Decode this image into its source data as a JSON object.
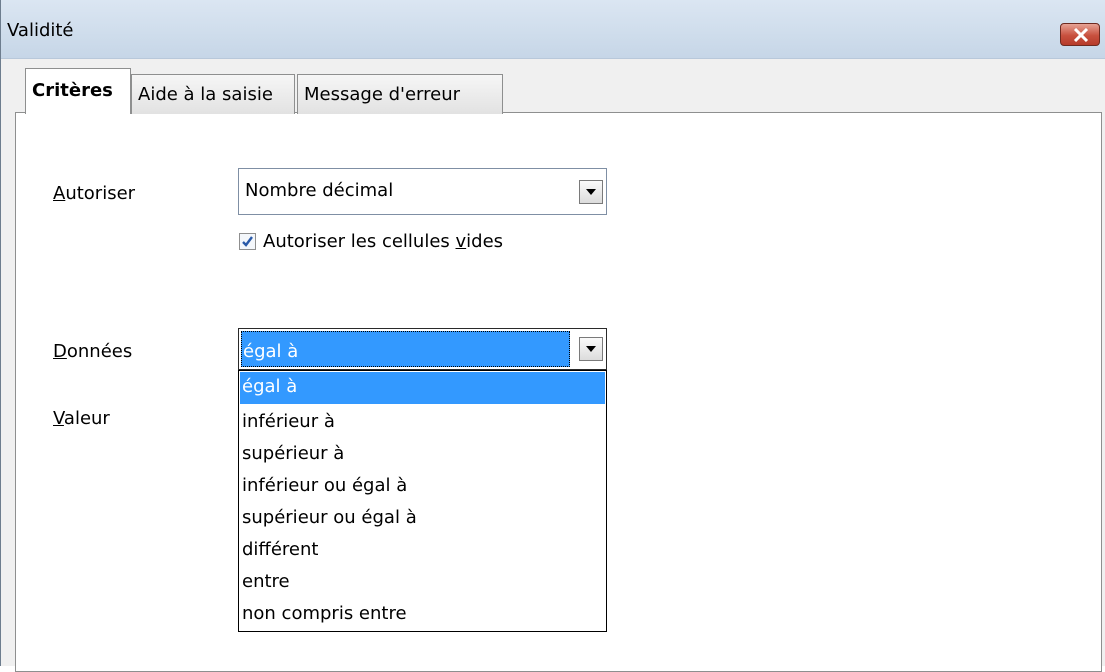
{
  "window": {
    "title": "Validité"
  },
  "tabs": [
    {
      "label": "Critères",
      "active": true
    },
    {
      "label": "Aide à la saisie",
      "active": false
    },
    {
      "label": "Message d'erreur",
      "active": false
    }
  ],
  "criteria": {
    "allow": {
      "label_accel": "A",
      "label_rest": "utoriser",
      "value": "Nombre décimal"
    },
    "allow_empty": {
      "checked": true,
      "label_pre": "Autoriser les cellules ",
      "label_accel": "v",
      "label_post": "ides"
    },
    "data": {
      "label_accel": "D",
      "label_rest": "onnées",
      "value": "égal à"
    },
    "value_label": {
      "label_accel": "V",
      "label_rest": "aleur"
    },
    "dropdown": {
      "selected_index": 0,
      "options": [
        "égal à",
        "inférieur à",
        "supérieur à",
        "inférieur ou égal à",
        "supérieur ou égal à",
        "différent",
        "entre",
        "non compris entre"
      ]
    }
  },
  "icons": {
    "close": "close-icon",
    "dropdown_arrow": "chevron-down-icon",
    "check": "checkmark-icon"
  },
  "colors": {
    "selection": "#3399ff",
    "close_button": "#c8503e",
    "titlebar": "#c6d6e7"
  }
}
